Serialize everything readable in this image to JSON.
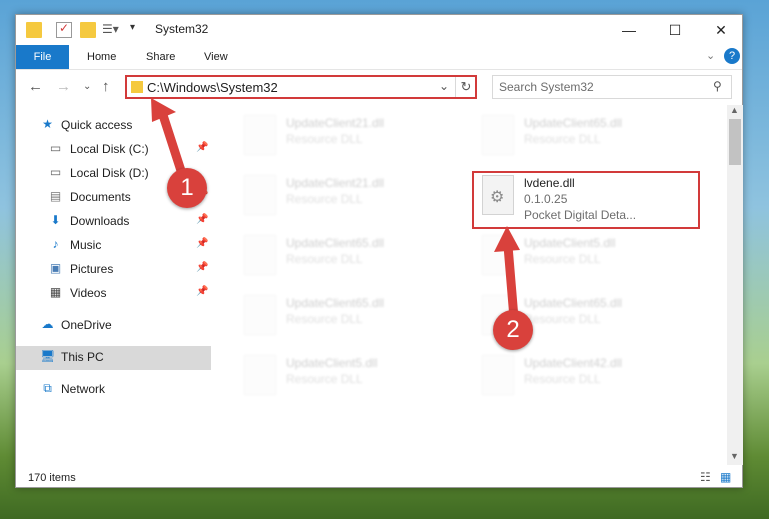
{
  "window": {
    "title": "System32"
  },
  "ribbon": {
    "tabs": [
      "File",
      "Home",
      "Share",
      "View"
    ]
  },
  "address": {
    "path": "C:\\Windows\\System32"
  },
  "search": {
    "placeholder": "Search System32"
  },
  "sidebar": {
    "items": [
      {
        "label": "Quick access",
        "icon": "star-icon"
      },
      {
        "label": "Local Disk (C:)",
        "icon": "drive-icon"
      },
      {
        "label": "Local Disk (D:)",
        "icon": "drive-icon"
      },
      {
        "label": "Documents",
        "icon": "documents-icon"
      },
      {
        "label": "Downloads",
        "icon": "downloads-icon"
      },
      {
        "label": "Music",
        "icon": "music-icon"
      },
      {
        "label": "Pictures",
        "icon": "pictures-icon"
      },
      {
        "label": "Videos",
        "icon": "videos-icon"
      },
      {
        "label": "OneDrive",
        "icon": "cloud-icon"
      },
      {
        "label": "This PC",
        "icon": "computer-icon"
      },
      {
        "label": "Network",
        "icon": "network-icon"
      }
    ]
  },
  "files": [
    {
      "name": "UpdateClient21.dll",
      "sub": "Resource DLL"
    },
    {
      "name": "UpdateClient65.dll",
      "sub": "Resource DLL"
    },
    {
      "name": "UpdateClient21.dll",
      "sub": "Resource DLL"
    },
    {
      "name": "lvdene.dll",
      "version": "0.1.0.25",
      "company": "Pocket Digital Deta..."
    },
    {
      "name": "UpdateClient65.dll",
      "sub": "Resource DLL"
    },
    {
      "name": "UpdateClient5.dll",
      "sub": "Resource DLL"
    },
    {
      "name": "UpdateClient65.dll",
      "sub": "Resource DLL"
    },
    {
      "name": "UpdateClient65.dll",
      "sub": "Resource DLL"
    },
    {
      "name": "UpdateClient5.dll",
      "sub": "Resource DLL"
    },
    {
      "name": "UpdateClient42.dll",
      "sub": "Resource DLL"
    }
  ],
  "status": {
    "count": "170 items"
  },
  "annotations": {
    "step1": "1",
    "step2": "2"
  },
  "colors": {
    "accent": "#1979ca",
    "highlight": "#d23a3a"
  }
}
